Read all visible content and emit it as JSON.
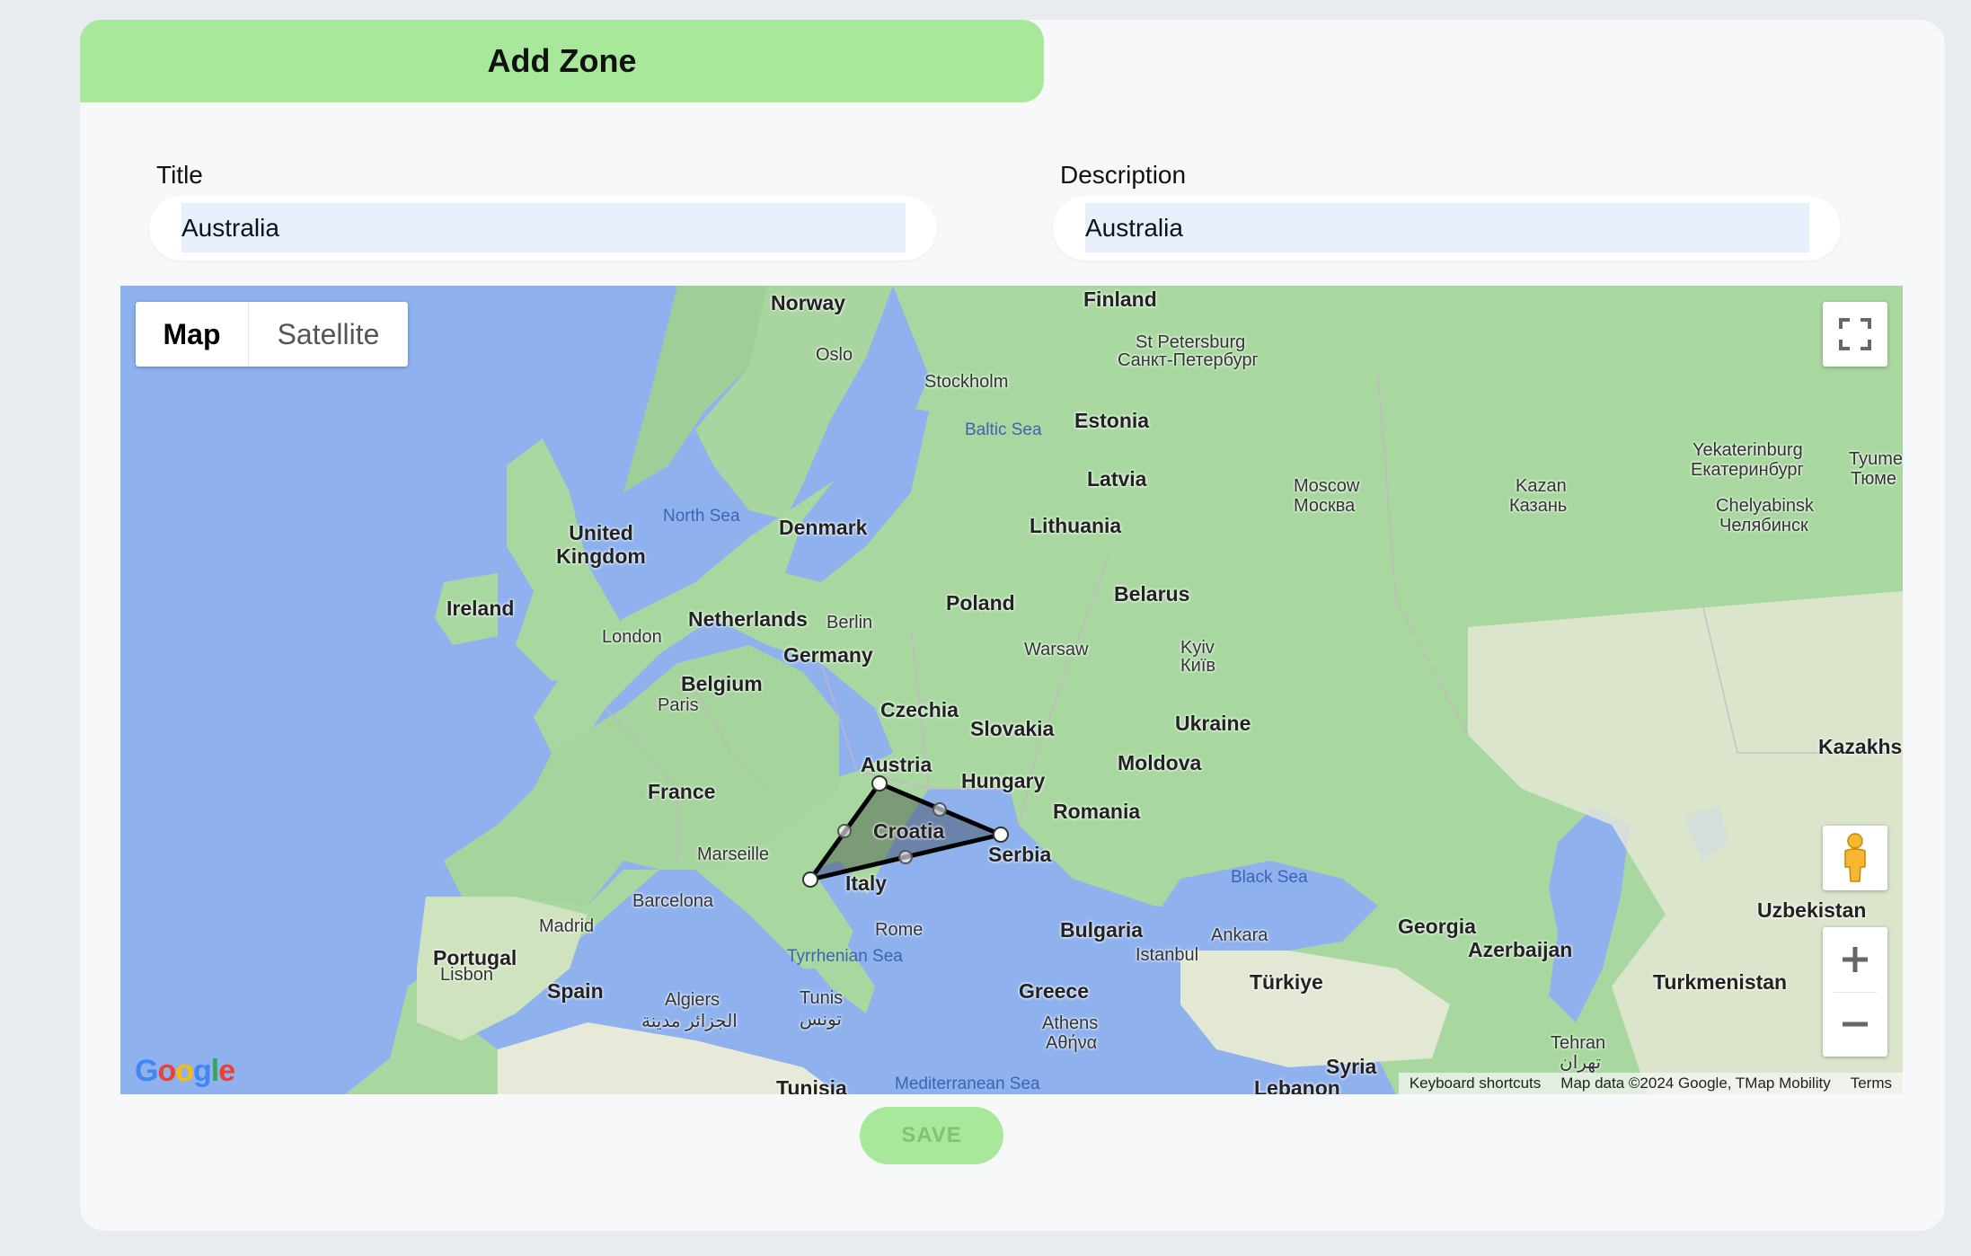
{
  "form": {
    "header_title": "Add Zone",
    "title_label": "Title",
    "title_value": "Australia",
    "description_label": "Description",
    "description_value": "Australia",
    "save_label": "SAVE"
  },
  "map": {
    "type_options": [
      "Map",
      "Satellite"
    ],
    "selected_type": "Map",
    "countries": [
      "Norway",
      "Finland",
      "Estonia",
      "Latvia",
      "Lithuania",
      "Denmark",
      "United Kingdom",
      "Ireland",
      "Netherlands",
      "Belgium",
      "Germany",
      "Poland",
      "Belarus",
      "Czechia",
      "Slovakia",
      "Austria",
      "Hungary",
      "Ukraine",
      "Moldova",
      "France",
      "Croatia",
      "Romania",
      "Serbia",
      "Italy",
      "Bulgaria",
      "Portugal",
      "Spain",
      "Greece",
      "Türkiye",
      "Georgia",
      "Azerbaijan",
      "Uzbekistan",
      "Turkmenistan",
      "Kazakhs",
      "Syria",
      "Tunisia",
      "Lebanon"
    ],
    "cities": [
      "Oslo",
      "Stockholm",
      "St Petersburg",
      "Санкт-Петербург",
      "Moscow",
      "Москва",
      "Kazan",
      "Казань",
      "Yekaterinburg",
      "Екатеринбург",
      "Chelyabinsk",
      "Челябинск",
      "Tyume",
      "Тюме",
      "London",
      "Berlin",
      "Warsaw",
      "Kyiv",
      "Київ",
      "Paris",
      "Marseille",
      "Rome",
      "Barcelona",
      "Madrid",
      "Lisbon",
      "Algiers",
      "الجزائر مدينة",
      "Tunis",
      "تونس",
      "Athens",
      "Αθήνα",
      "Istanbul",
      "Ankara",
      "Tehran",
      "تهران"
    ],
    "seas": [
      "North Sea",
      "Baltic Sea",
      "Black Sea",
      "Tyrrhenian Sea",
      "Mediterranean Sea"
    ],
    "attribution": {
      "shortcuts": "Keyboard shortcuts",
      "data": "Map data ©2024 Google, TMap Mobility",
      "terms": "Terms"
    },
    "logo": "Google",
    "zone_polygon_color": "#000000",
    "controls": [
      "fullscreen-icon",
      "pegman-icon",
      "zoom-in-icon",
      "zoom-out-icon"
    ]
  },
  "colors": {
    "accent": "#a8e89a",
    "water": "#8fb2ef",
    "land": "#a8d8a0"
  }
}
